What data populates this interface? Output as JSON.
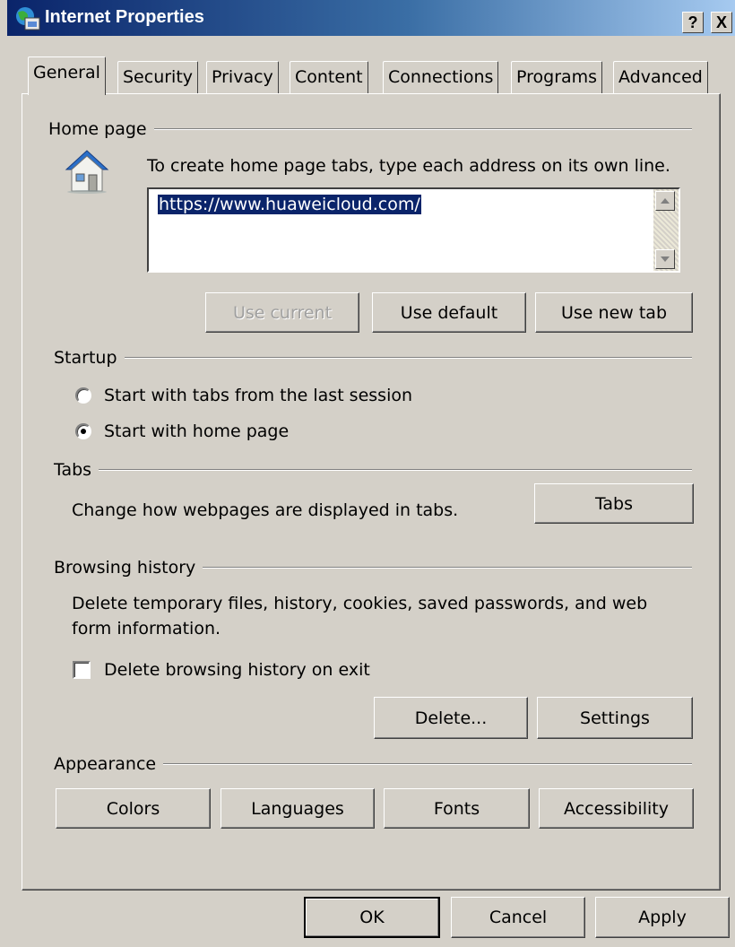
{
  "window": {
    "title": "Internet Properties",
    "help_btn": "?",
    "close_btn": "X",
    "icon": "internet-properties-icon"
  },
  "tabs": [
    "General",
    "Security",
    "Privacy",
    "Content",
    "Connections",
    "Programs",
    "Advanced"
  ],
  "active_tab": "General",
  "home_page": {
    "group_label": "Home page",
    "icon": "house-icon",
    "instruction": "To create home page tabs, type each address on its own line.",
    "url": "https://www.huaweicloud.com/",
    "use_current": "Use current",
    "use_default": "Use default",
    "use_new_tab": "Use new tab"
  },
  "startup": {
    "group_label": "Startup",
    "option_last_session": "Start with tabs from the last session",
    "option_home_page": "Start with home page",
    "selected": "option_home_page"
  },
  "tabs_group": {
    "group_label": "Tabs",
    "description": "Change how webpages are displayed in tabs.",
    "button": "Tabs"
  },
  "history": {
    "group_label": "Browsing history",
    "description_line1": "Delete temporary files, history, cookies, saved passwords, and web",
    "description_line2": "form information.",
    "checkbox": "Delete browsing history on exit",
    "checked": false,
    "delete_btn": "Delete...",
    "settings_btn": "Settings"
  },
  "appearance": {
    "group_label": "Appearance",
    "colors": "Colors",
    "languages": "Languages",
    "fonts": "Fonts",
    "accessibility": "Accessibility"
  },
  "footer": {
    "ok": "OK",
    "cancel": "Cancel",
    "apply": "Apply"
  },
  "colors": {
    "dialog_bg": "#d4d0c8",
    "title_start": "#0a246a",
    "selection": "#0a246a"
  }
}
